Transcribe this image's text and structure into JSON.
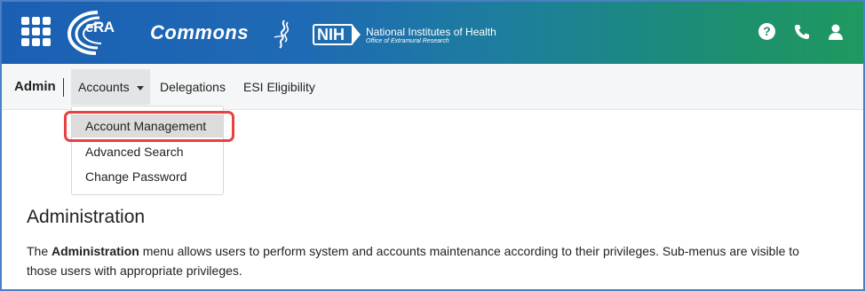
{
  "header": {
    "era_logo_text": "eRA",
    "app_name": "Commons",
    "nih_abbrev": "NIH",
    "nih_name": "National Institutes of Health",
    "nih_office": "Office of Extramural Research",
    "icons": [
      "apps-grid-icon",
      "help-icon",
      "phone-icon",
      "user-icon"
    ],
    "help_glyph": "?"
  },
  "nav": {
    "section": "Admin",
    "items": [
      {
        "label": "Accounts",
        "has_dropdown": true,
        "active": true
      },
      {
        "label": "Delegations"
      },
      {
        "label": "ESI Eligibility"
      }
    ]
  },
  "dropdown": {
    "items": [
      {
        "label": "Account Management",
        "highlighted": true
      },
      {
        "label": "Advanced Search"
      },
      {
        "label": "Change Password"
      }
    ]
  },
  "main": {
    "title": "Administration",
    "para_prefix": "The",
    "para_bold": "Administration",
    "para_rest": "menu allows users to perform system and accounts maintenance according to their privileges. Sub-menus are visible to those users with appropriate privileges."
  },
  "colors": {
    "header_start": "#1b5fb3",
    "header_end": "#1f9960",
    "highlight": "#e8413f",
    "frame_border": "#4a7fc1"
  }
}
